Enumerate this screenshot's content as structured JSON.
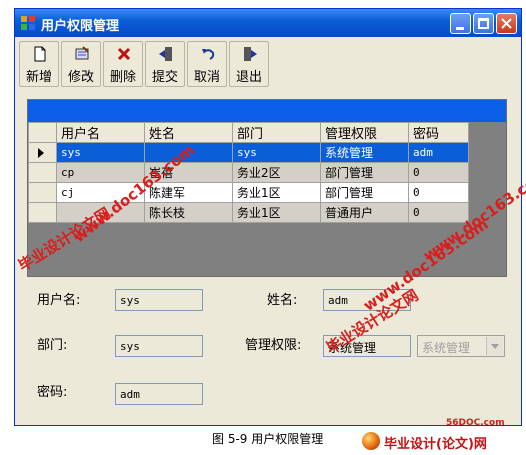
{
  "window": {
    "title": "用户权限管理"
  },
  "toolbar": {
    "buttons": [
      {
        "label": "新增",
        "icon": "new-document-icon"
      },
      {
        "label": "修改",
        "icon": "edit-icon"
      },
      {
        "label": "删除",
        "icon": "delete-x-icon"
      },
      {
        "label": "提交",
        "icon": "submit-icon"
      },
      {
        "label": "取消",
        "icon": "undo-icon"
      },
      {
        "label": "退出",
        "icon": "exit-door-icon"
      }
    ]
  },
  "grid": {
    "columns": [
      "用户名",
      "姓名",
      "部门",
      "管理权限",
      "密码"
    ],
    "rows": [
      {
        "username": "sys",
        "name": "",
        "dept": "sys",
        "role": "系统管理",
        "password": "adm",
        "selected": true
      },
      {
        "username": "cp",
        "name": "崔蓓",
        "dept": "务业2区",
        "role": "部门管理",
        "password": "0"
      },
      {
        "username": "cj",
        "name": "陈建军",
        "dept": "务业1区",
        "role": "部门管理",
        "password": "0"
      },
      {
        "username": "",
        "name": "陈长枝",
        "dept": "务业1区",
        "role": "普通用户",
        "password": "0"
      }
    ]
  },
  "form": {
    "username_label": "用户名:",
    "username_value": "sys",
    "name_label": "姓名:",
    "name_value": "adm",
    "dept_label": "部门:",
    "dept_value": "sys",
    "role_label": "管理权限:",
    "role_value": "系统管理",
    "role_select_value": "系统管理",
    "password_label": "密码:",
    "password_value": "adm"
  },
  "watermarks": {
    "site_text": "www.doc163.com",
    "brand_text": "毕业设计论文网"
  },
  "caption": "图 5-9 用户权限管理",
  "footer_logo": {
    "site": "56DOC.com",
    "name": "毕业设计(论文)网"
  },
  "colors": {
    "titlebar": "#0a5fd8",
    "selection": "#0a5fd8",
    "watermark": "#d91e1e"
  }
}
